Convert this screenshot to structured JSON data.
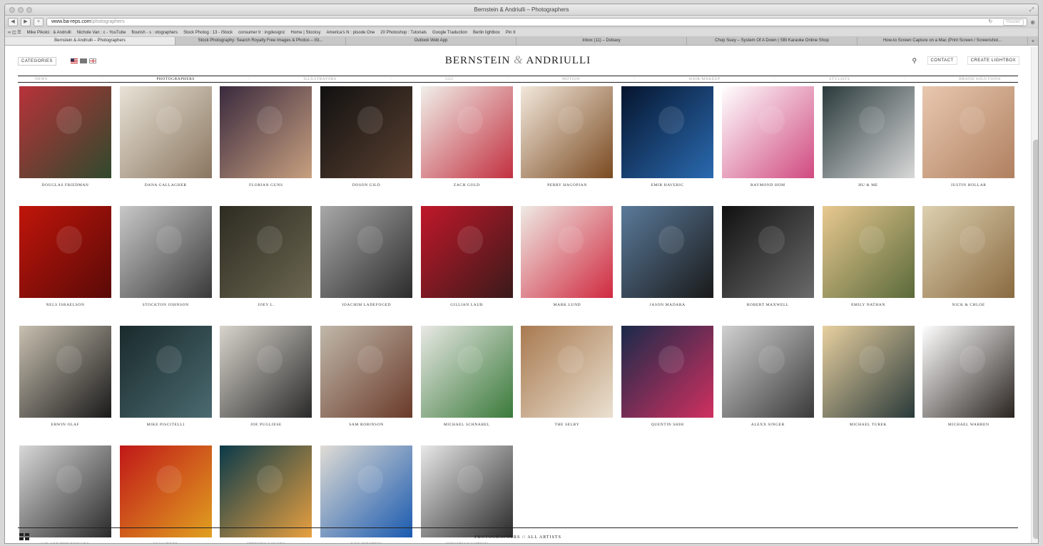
{
  "window": {
    "title": "Bernstein & Andriulli – Photographers"
  },
  "browser": {
    "url_host": "www.ba-reps.com",
    "url_path": "/photographers",
    "reader_label": "Reader",
    "bookmarks": [
      "Mike Pikolci : & Andrulli",
      "Nichole Van : c - YouTube",
      "flourish - s : otographers",
      "Stock Photog : 13 - iStock",
      "consumer tr : ingdesignz",
      "Home | Stocksy",
      "America's N : pisode One",
      "20 Photoshop : Tutorials",
      "Google Traduction",
      "Berlin lightbox",
      "Pin It"
    ],
    "tabs": [
      "Bernstein & Andriulli – Photographers",
      "Stock Photography: Search Royalty Free Images & Photos – iSt...",
      "Outlook Web App",
      "Inbox (11) – Dobaxy",
      "Chop Suey – System Of A Down | SBI Karaoke Online Shop",
      "How-to Screen Capture on a Mac (Print Screen / Screenshot..."
    ]
  },
  "header": {
    "categories_label": "CATEGORIES",
    "logo_left": "BERNSTEIN",
    "logo_amp": "&",
    "logo_right": "ANDRIULLI",
    "contact_label": "CONTACT",
    "lightbox_label": "CREATE LIGHTBOX"
  },
  "nav": [
    "NEWS",
    "PHOTOGRAPHERS",
    "ILLUSTRATORS",
    "CGI",
    "MOTION",
    "HAIR/MAKEUP",
    "STYLISTS",
    "BRAND SOLUTIONS"
  ],
  "nav_active": "PHOTOGRAPHERS",
  "artists": [
    {
      "name": "DOUGLAS FRIEDMAN",
      "c1": "#b8323a",
      "c2": "#2f4a2c"
    },
    {
      "name": "DANA GALLAGHER",
      "c1": "#e8e2d6",
      "c2": "#8a7660"
    },
    {
      "name": "FLORIAN GUNS",
      "c1": "#3a2a3e",
      "c2": "#c8a080"
    },
    {
      "name": "DOSON GILD",
      "c1": "#111111",
      "c2": "#5a4030"
    },
    {
      "name": "ZACH GOLD",
      "c1": "#f0efe9",
      "c2": "#c23040"
    },
    {
      "name": "PERRY HAGOPIAN",
      "c1": "#f2e8dc",
      "c2": "#7a4a20"
    },
    {
      "name": "EMIR HAVERIC",
      "c1": "#06152e",
      "c2": "#2a6ab0"
    },
    {
      "name": "RAYMOND HOM",
      "c1": "#ffffff",
      "c2": "#d04a80"
    },
    {
      "name": "HU & ME",
      "c1": "#2a3a3c",
      "c2": "#d8d8d8"
    },
    {
      "name": "JUSTIN HOLLAR",
      "c1": "#e8c8b0",
      "c2": "#b08060"
    },
    {
      "name": "NELS ISRAELSON",
      "c1": "#c0150a",
      "c2": "#5a0a08"
    },
    {
      "name": "STOCKTON JOHNSON",
      "c1": "#c8c8c8",
      "c2": "#3a3a3a"
    },
    {
      "name": "JOEY L.",
      "c1": "#2e2c22",
      "c2": "#6a6650"
    },
    {
      "name": "JOACHIM LADEFOGED",
      "c1": "#a8a8a8",
      "c2": "#2c2c2c"
    },
    {
      "name": "GILLIAN LAUB",
      "c1": "#c0182a",
      "c2": "#3a1a1a"
    },
    {
      "name": "MARK LUND",
      "c1": "#eeeae4",
      "c2": "#d02a40"
    },
    {
      "name": "JASON MADARA",
      "c1": "#5a7a9a",
      "c2": "#1a1a1a"
    },
    {
      "name": "ROBERT MAXWELL",
      "c1": "#111111",
      "c2": "#6a6a6a"
    },
    {
      "name": "EMILY NATHAN",
      "c1": "#e8c890",
      "c2": "#5a6a3a"
    },
    {
      "name": "NICK & CHLOE",
      "c1": "#dcd0b0",
      "c2": "#8a6a40"
    },
    {
      "name": "ERWIN OLAF",
      "c1": "#c8c0b0",
      "c2": "#1a1a1a"
    },
    {
      "name": "MIKE PISCITELLI",
      "c1": "#1a2a2c",
      "c2": "#4a6a70"
    },
    {
      "name": "JOE PUGLIESE",
      "c1": "#d8d4cc",
      "c2": "#2a2a2a"
    },
    {
      "name": "SAM ROBINSON",
      "c1": "#c0b8aa",
      "c2": "#6a3a2a"
    },
    {
      "name": "MICHAEL SCHNABEL",
      "c1": "#e8e8e4",
      "c2": "#3a7a3a"
    },
    {
      "name": "THE SELBY",
      "c1": "#a87a50",
      "c2": "#eae0d0"
    },
    {
      "name": "QUENTIN SHIH",
      "c1": "#1a2a4a",
      "c2": "#d03060"
    },
    {
      "name": "ALEXX SINGER",
      "c1": "#d0d0d0",
      "c2": "#3a3a3a"
    },
    {
      "name": "MICHAEL TUREK",
      "c1": "#e8d0a0",
      "c2": "#2a3a3a"
    },
    {
      "name": "MICHAEL WARREN",
      "c1": "#ffffff",
      "c2": "#2a2420"
    },
    {
      "name": "WE ARE THE RHOADS",
      "c1": "#d8d8d8",
      "c2": "#2a2a2a"
    },
    {
      "name": "ULI WEBER",
      "c1": "#c01818",
      "c2": "#e0a020"
    },
    {
      "name": "STEPHEN WILKES",
      "c1": "#0a3a4a",
      "c2": "#e8a040"
    },
    {
      "name": "ROY ZIPSTEIN",
      "c1": "#e0dcd4",
      "c2": "#1a5ab0"
    },
    {
      "name": "CHRISTIAN WITKIN",
      "c1": "#e8e8e8",
      "c2": "#2a2a2a"
    }
  ],
  "footer": {
    "label": "PHOTOGRAPHERS // ALL ARTISTS"
  }
}
